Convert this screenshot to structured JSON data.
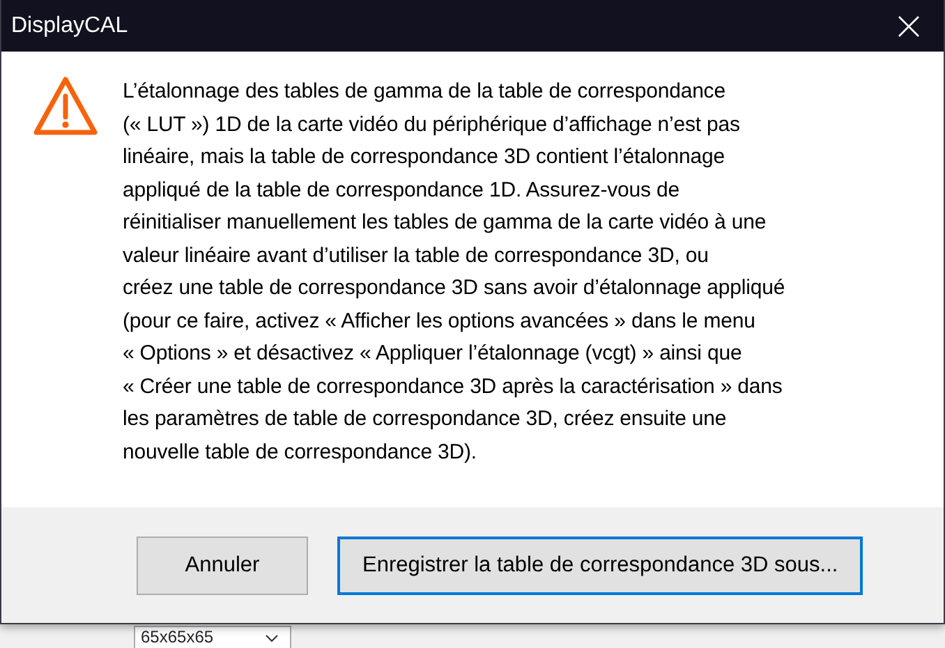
{
  "window": {
    "title": "DisplayCAL"
  },
  "message": {
    "lines": [
      "L’étalonnage des tables de gamma de la table de correspondance",
      "(« LUT ») 1D de la carte vidéo du périphérique d’affichage n’est pas",
      "linéaire, mais la table de correspondance 3D contient l’étalonnage",
      "appliqué de la table de correspondance 1D. Assurez-vous de",
      "réinitialiser manuellement les tables de gamma de la carte vidéo à une",
      "valeur linéaire avant d’utiliser la table de correspondance 3D, ou",
      "créez une table de correspondance 3D sans avoir d’étalonnage appliqué",
      "(pour ce faire, activez « Afficher les options avancées » dans le menu",
      "« Options » et désactivez « Appliquer l’étalonnage (vcgt) » ainsi que",
      "« Créer une table de correspondance 3D après la caractérisation » dans",
      "les paramètres de table de correspondance 3D, créez ensuite une",
      "nouvelle table de correspondance 3D)."
    ]
  },
  "buttons": [
    {
      "label": "Annuler",
      "selected": false
    },
    {
      "label": "Enregistrer la table de correspondance 3D sous...",
      "selected": true
    }
  ],
  "background": {
    "dropdown_value": "65x65x65"
  }
}
